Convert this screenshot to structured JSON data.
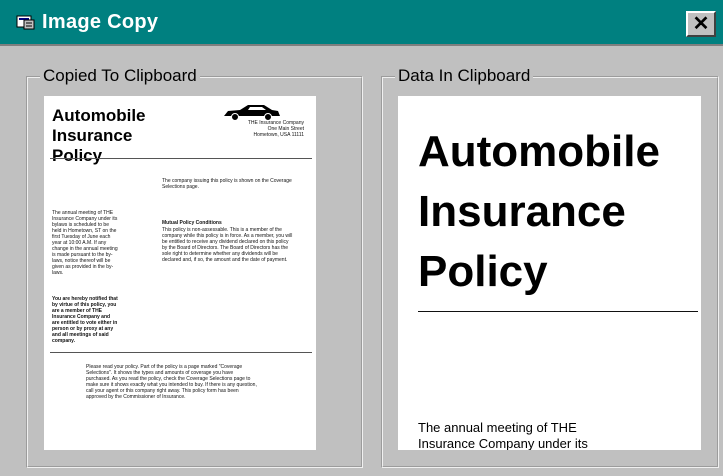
{
  "window": {
    "title": "Image Copy",
    "close_label": "✕",
    "titlebar_color": "#008080"
  },
  "left_panel": {
    "label": "Copied To Clipboard",
    "document": {
      "title": "Automobile Insurance Policy",
      "company_lines": [
        "THE Insurance Company",
        "One Main Street",
        "Hometown, USA 11111"
      ],
      "para_coverage": "The company issuing this policy is shown on the Coverage Selections page.",
      "para_annual": "The annual meeting of THE Insurance Company under its bylaws is scheduled to be held in Hometown, ST on the first Tuesday of June each year at 10:00 A.M. If any change in the annual meeting is made pursuant to the by-laws, notice thereof will be given as provided in the by-laws.",
      "heading_mutual": "Mutual Policy Conditions",
      "para_mutual": "This policy is non-assessable. This is a member of the company while this policy is in force. As a member, you will be entitled to receive any dividend declared on this policy by the Board of Directors. The Board of Directors has the sole right to determine whether any dividends will be declared and, if so, the amount and the date of payment.",
      "para_notice": "You are hereby notified that by virtue of this policy, you are a member of THE Insurance Company and are entitled to vote either in person or by proxy at any and all meetings of said company.",
      "para_read": "Please read your policy. Part of the policy is a page marked \"Coverage Selections\". It shows the types and amounts of coverage you have purchased. As you read the policy, check the Coverage Selections page to make sure it shows exactly what you intended to buy. If there is any question, call your agent or this company right away. This policy form has been approved by the Commissioner of Insurance."
    }
  },
  "right_panel": {
    "label": "Data In Clipboard",
    "title": "Automobile Insurance Policy",
    "title_lines": [
      "Automobile",
      "Insurance",
      "Policy"
    ],
    "text_line1": "The annual meeting of THE",
    "text_line2": "Insurance Company under its"
  }
}
